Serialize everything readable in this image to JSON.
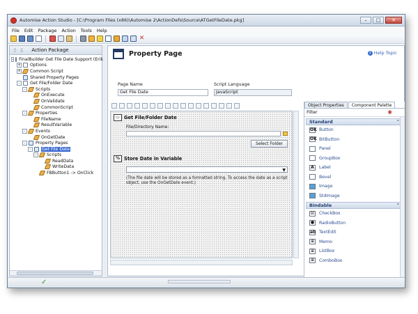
{
  "window": {
    "title": "Automise Action Studio - [C:\\Program Files (x86)\\Automise 2\\ActionDefs\\Source\\ATGetFileDate.pkg]",
    "buttons": {
      "minimize": "–",
      "maximize": "□",
      "close": "✕"
    }
  },
  "menu": [
    "File",
    "Edit",
    "Package",
    "Action",
    "Tools",
    "Help"
  ],
  "left_panel": {
    "title": "Action Package",
    "tree": [
      {
        "label": "FinalBuilder Get File Date Support (Erik",
        "level": 0,
        "icon": "doc",
        "exp": "-"
      },
      {
        "label": "Options",
        "level": 1,
        "icon": "doc",
        "exp": "+"
      },
      {
        "label": "Common Script",
        "level": 1,
        "icon": "script",
        "exp": "+"
      },
      {
        "label": "Shared Property Pages",
        "level": 1,
        "icon": "page",
        "exp": ""
      },
      {
        "label": "Get File/Folder Date",
        "level": 1,
        "icon": "doc",
        "exp": "-"
      },
      {
        "label": "Scripts",
        "level": 2,
        "icon": "script",
        "exp": "-"
      },
      {
        "label": "OnExecute",
        "level": 3,
        "icon": "script",
        "exp": ""
      },
      {
        "label": "OnValidate",
        "level": 3,
        "icon": "script",
        "exp": ""
      },
      {
        "label": "CommonScript",
        "level": 3,
        "icon": "script",
        "exp": ""
      },
      {
        "label": "Properties",
        "level": 2,
        "icon": "script",
        "exp": "-"
      },
      {
        "label": "FileName",
        "level": 3,
        "icon": "script",
        "exp": ""
      },
      {
        "label": "ResultVariable",
        "level": 3,
        "icon": "script",
        "exp": ""
      },
      {
        "label": "Events",
        "level": 2,
        "icon": "script",
        "exp": "-"
      },
      {
        "label": "OnGetDate",
        "level": 3,
        "icon": "script",
        "exp": ""
      },
      {
        "label": "Property Pages",
        "level": 2,
        "icon": "page",
        "exp": "-"
      },
      {
        "label": "Get File Date",
        "level": 3,
        "icon": "page",
        "exp": "-",
        "selected": true
      },
      {
        "label": "Scripts",
        "level": 4,
        "icon": "script",
        "exp": "-"
      },
      {
        "label": "ReadData",
        "level": 5,
        "icon": "script",
        "exp": ""
      },
      {
        "label": "WriteData",
        "level": 5,
        "icon": "script",
        "exp": ""
      },
      {
        "label": "FBButton1 -> OnClick",
        "level": 4,
        "icon": "script",
        "exp": ""
      }
    ]
  },
  "property_page": {
    "title": "Property Page",
    "help": "Help Topic",
    "page_name_label": "Page Name",
    "page_name_value": "Get File Date",
    "script_language_label": "Script Language",
    "script_language_value": "JavaScript"
  },
  "canvas": {
    "group1_title": "Get File/Folder Date",
    "file_dir_label": "File/Directory Name:",
    "select_folder": "Select Folder",
    "group2_title": "Store Date in Variable",
    "note": "(The file date will be stored as a formatted string. To access the date as a script object, use the OnGetDate event.)"
  },
  "palette": {
    "tabs": [
      "Object Properties",
      "Component Palette"
    ],
    "filter_label": "Filter",
    "categories": [
      {
        "name": "Standard",
        "items": [
          "Button",
          "BitButton",
          "Panel",
          "GroupBox",
          "Label",
          "Bevel",
          "Image",
          "StdImage"
        ]
      },
      {
        "name": "Bindable",
        "items": [
          "CheckBox",
          "RadioButton",
          "TextEdit",
          "Memo",
          "ListBox",
          "ComboBox"
        ]
      }
    ]
  },
  "status": {
    "check": "✓"
  }
}
